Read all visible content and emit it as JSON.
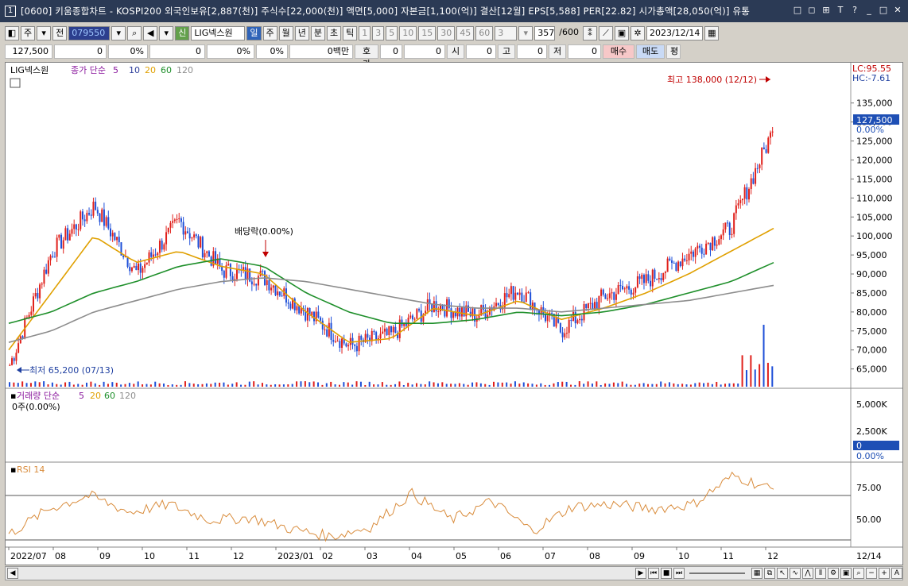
{
  "window": {
    "number": "1",
    "title": "[0600] 키움종합차트 - KOSPI200 외국인보유[2,887(천)] 주식수[22,000(천)] 액면[5,000] 자본금[1,100(억)] 결산[12월] EPS[5,588] PER[22.82] 시가총액[28,050(억)] 유통",
    "buttons": [
      "□",
      "◻",
      "⊞",
      "T",
      "?",
      "_",
      "□",
      "✕"
    ]
  },
  "toolbar": {
    "market": "주",
    "prev": "전",
    "code": "079550",
    "stock_badge": "신",
    "stock_name": "LIG넥스원",
    "periods": [
      "일",
      "주",
      "월",
      "년",
      "분",
      "초",
      "틱"
    ],
    "active_period": "일",
    "numbers": [
      "1",
      "3",
      "5",
      "10",
      "15",
      "30",
      "45",
      "60"
    ],
    "count_sel": "3",
    "count": "357",
    "count_max": "/600",
    "date": "2023/12/14"
  },
  "quote": {
    "price": "127,500",
    "change": "0",
    "change_pct": "0%",
    "volume": "0",
    "vol_pct": "0%",
    "vol_pct2": "0%",
    "trade_amount": "0백만",
    "hoga_label": "호가",
    "hoga1": "0",
    "hoga2": "0",
    "open_label": "시",
    "open": "0",
    "high_label": "고",
    "high": "0",
    "low_label": "저",
    "low": "0",
    "buy_label": "매수",
    "sell_label": "매도",
    "eval_label": "평"
  },
  "chart_data": [
    {
      "type": "line",
      "name": "price",
      "legend": {
        "stock": "LIG넥스원",
        "label": "종가 단순",
        "mas": [
          "5",
          "10",
          "20",
          "60",
          "120"
        ]
      },
      "ma_colors": {
        "5": "#8b1a9e",
        "10": "#2a3c9a",
        "20": "#e0a000",
        "60": "#1e8f2a",
        "120": "#8c8c8c"
      },
      "top_right": {
        "lc": "LC:95.55",
        "hc": "HC:-7.61"
      },
      "last_price_label": "127,500",
      "last_pct_label": "0.00%",
      "annotations": {
        "high": "최고 138,000 (12/12)",
        "low": "최저 65,200 (07/13)",
        "dividend": "배당락(0.00%)"
      },
      "yticks": [
        "135,000",
        "130,000",
        "125,000",
        "120,000",
        "115,000",
        "110,000",
        "105,000",
        "100,000",
        "95,000",
        "90,000",
        "85,000",
        "80,000",
        "75,000",
        "70,000",
        "65,000"
      ],
      "ylim": [
        62000,
        141000
      ],
      "x_labels": [
        "2022/07",
        "08",
        "09",
        "10",
        "11",
        "12",
        "2023/01",
        "02",
        "03",
        "04",
        "05",
        "06",
        "07",
        "08",
        "09",
        "10",
        "11",
        "12"
      ],
      "end_label": "12/14",
      "x": [
        "2022-07",
        "2022-08",
        "2022-09",
        "2022-10",
        "2022-11",
        "2022-12",
        "2023-01",
        "2023-02",
        "2023-03",
        "2023-04",
        "2023-05",
        "2023-06",
        "2023-07",
        "2023-08",
        "2023-09",
        "2023-10",
        "2023-11",
        "2023-12a",
        "2023-12b"
      ],
      "series": [
        {
          "name": "종가",
          "values": [
            66000,
            96000,
            108000,
            90000,
            104000,
            91000,
            89000,
            80000,
            71000,
            74000,
            82000,
            79000,
            86000,
            75000,
            84000,
            88000,
            95000,
            102000,
            127500
          ]
        },
        {
          "name": "20",
          "values": [
            70000,
            85000,
            100000,
            93000,
            96000,
            92000,
            90000,
            80000,
            72000,
            73000,
            81000,
            79000,
            83000,
            78000,
            81000,
            85000,
            90000,
            96000,
            102000
          ]
        },
        {
          "name": "60",
          "values": [
            77000,
            80000,
            85000,
            88000,
            92000,
            94000,
            92000,
            85000,
            80000,
            77000,
            77000,
            78000,
            80000,
            79000,
            80000,
            82000,
            85000,
            88000,
            93000
          ]
        },
        {
          "name": "120",
          "values": [
            72000,
            75000,
            80000,
            83000,
            86000,
            88000,
            89000,
            88000,
            86000,
            84000,
            82000,
            81000,
            81000,
            80000,
            81000,
            82000,
            83000,
            85000,
            87000
          ]
        }
      ]
    },
    {
      "type": "bar",
      "name": "volume",
      "legend": {
        "label": "거래량 단순",
        "mas": [
          "5",
          "20",
          "60",
          "120"
        ]
      },
      "sub_label": "0주(0.00%)",
      "yticks": [
        "5,000K",
        "2,500K"
      ],
      "ylim": [
        0,
        5600
      ],
      "last_label": "0",
      "pct_label": "0.00%"
    },
    {
      "type": "line",
      "name": "rsi",
      "legend": {
        "label": "RSI 14"
      },
      "yticks": [
        "75.00",
        "50.00"
      ],
      "ylim": [
        25,
        95
      ],
      "values": [
        35,
        58,
        70,
        55,
        62,
        48,
        50,
        40,
        33,
        42,
        72,
        48,
        65,
        38,
        60,
        62,
        58,
        62,
        88,
        75
      ]
    }
  ]
}
